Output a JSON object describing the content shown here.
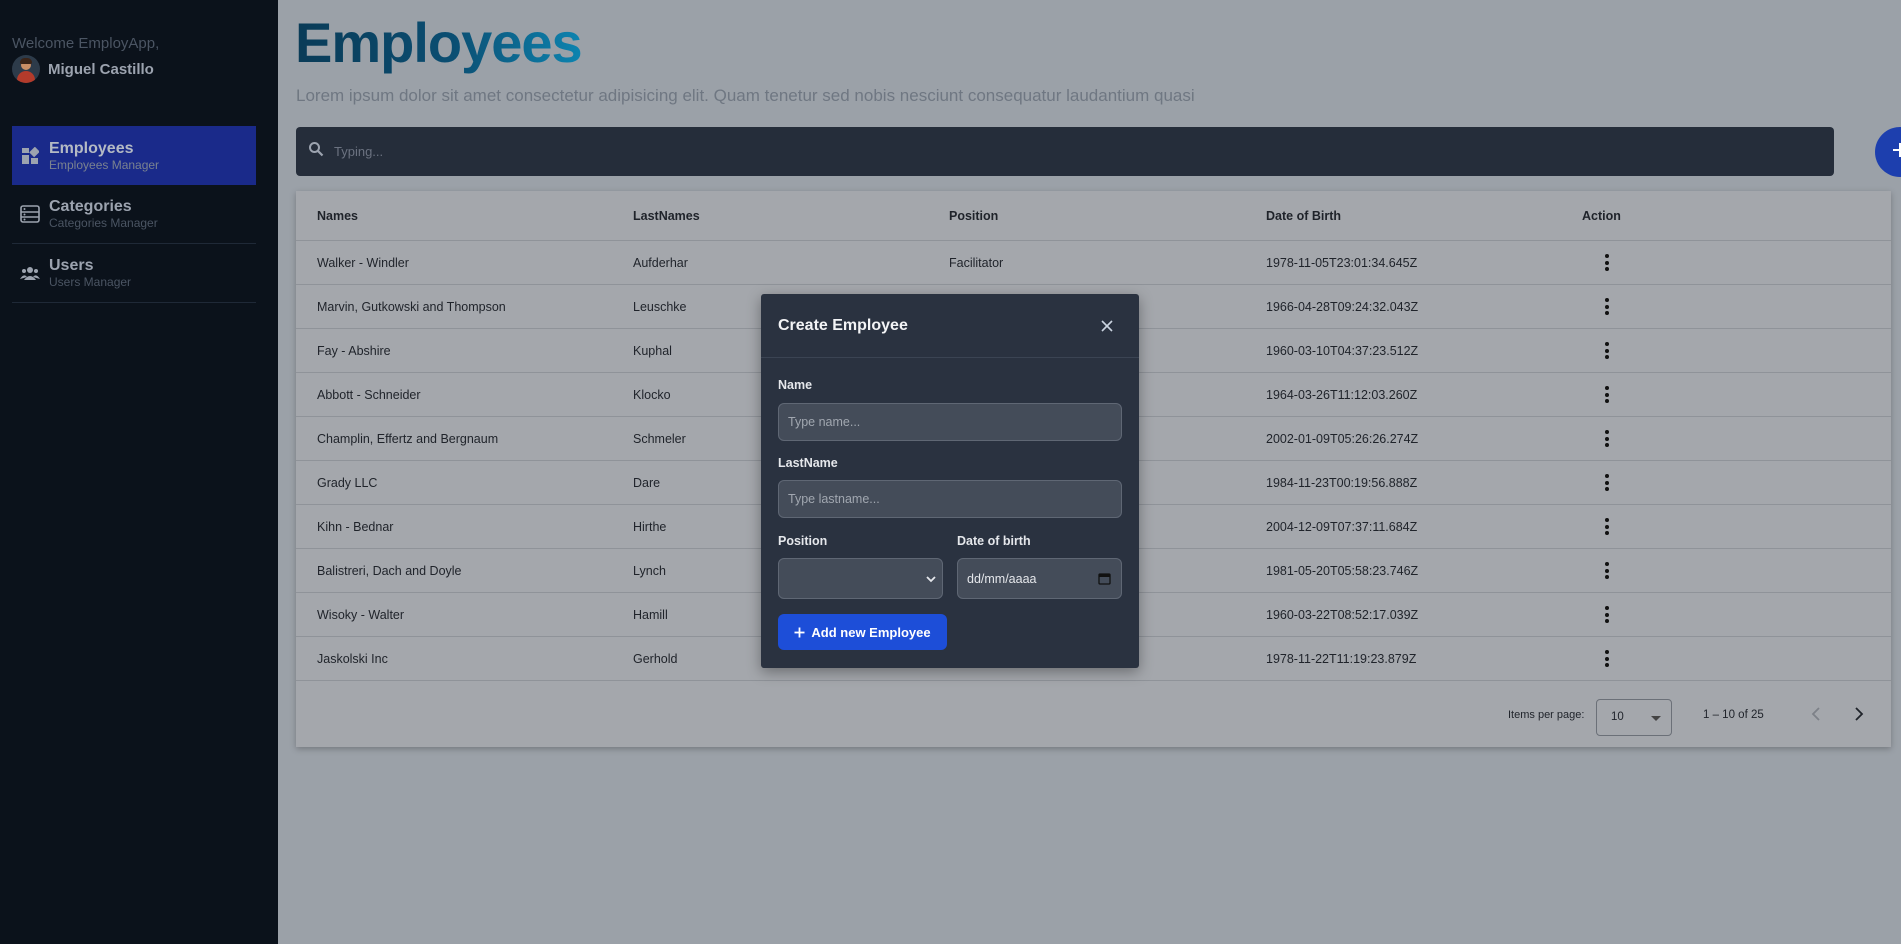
{
  "sidebar": {
    "welcome": "Welcome EmployApp,",
    "user_name": "Miguel Castillo",
    "items": [
      {
        "title": "Employees",
        "subtitle": "Employees Manager",
        "icon": "dashboard-icon"
      },
      {
        "title": "Categories",
        "subtitle": "Categories Manager",
        "icon": "list-icon"
      },
      {
        "title": "Users",
        "subtitle": "Users Manager",
        "icon": "users-icon"
      }
    ]
  },
  "main": {
    "title": "Employees",
    "subtitle": "Lorem ipsum dolor sit amet consectetur adipisicing elit. Quam tenetur sed nobis nesciunt consequatur laudantium quasi",
    "search_placeholder": "Typing...",
    "add_icon": "plus-icon"
  },
  "table": {
    "columns": [
      "Names",
      "LastNames",
      "Position",
      "Date of Birth",
      "Action"
    ],
    "rows": [
      {
        "name": "Walker - Windler",
        "lastname": "Aufderhar",
        "position": "Facilitator",
        "dob": "1978-11-05T23:01:34.645Z"
      },
      {
        "name": "Marvin, Gutkowski and Thompson",
        "lastname": "Leuschke",
        "position": "",
        "dob": "1966-04-28T09:24:32.043Z"
      },
      {
        "name": "Fay - Abshire",
        "lastname": "Kuphal",
        "position": "",
        "dob": "1960-03-10T04:37:23.512Z"
      },
      {
        "name": "Abbott - Schneider",
        "lastname": "Klocko",
        "position": "",
        "dob": "1964-03-26T11:12:03.260Z"
      },
      {
        "name": "Champlin, Effertz and Bergnaum",
        "lastname": "Schmeler",
        "position": "",
        "dob": "2002-01-09T05:26:26.274Z"
      },
      {
        "name": "Grady LLC",
        "lastname": "Dare",
        "position": "",
        "dob": "1984-11-23T00:19:56.888Z"
      },
      {
        "name": "Kihn - Bednar",
        "lastname": "Hirthe",
        "position": "",
        "dob": "2004-12-09T07:37:11.684Z"
      },
      {
        "name": "Balistreri, Dach and Doyle",
        "lastname": "Lynch",
        "position": "",
        "dob": "1981-05-20T05:58:23.746Z"
      },
      {
        "name": "Wisoky - Walter",
        "lastname": "Hamill",
        "position": "",
        "dob": "1960-03-22T08:52:17.039Z"
      },
      {
        "name": "Jaskolski Inc",
        "lastname": "Gerhold",
        "position": "",
        "dob": "1978-11-22T11:19:23.879Z"
      }
    ]
  },
  "paginator": {
    "items_per_page_label": "Items per page:",
    "items_per_page": "10",
    "range": "1 – 10 of 25"
  },
  "modal": {
    "title": "Create Employee",
    "name_label": "Name",
    "name_placeholder": "Type name...",
    "lastname_label": "LastName",
    "lastname_placeholder": "Type lastname...",
    "position_label": "Position",
    "position_value": "",
    "dob_label": "Date of birth",
    "dob_placeholder": "dd/mm/aaaa",
    "submit_label": "Add new Employee"
  }
}
